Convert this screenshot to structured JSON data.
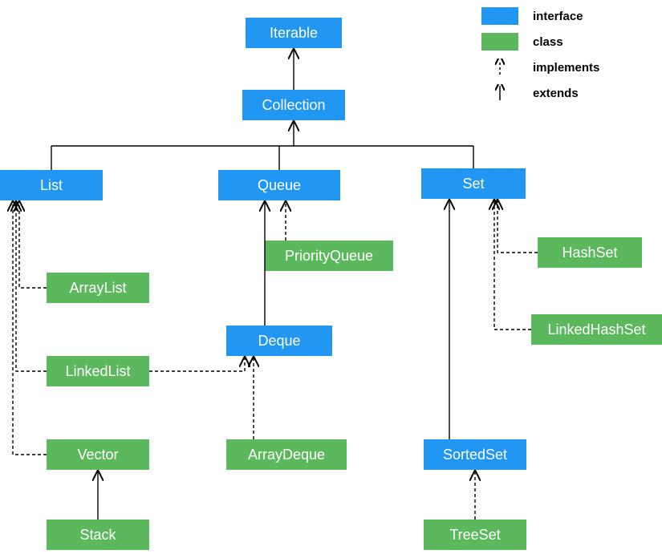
{
  "legend": {
    "interface": "interface",
    "class": "class",
    "implements": "implements",
    "extends": "extends"
  },
  "nodes": {
    "iterable": "Iterable",
    "collection": "Collection",
    "list": "List",
    "queue": "Queue",
    "set": "Set",
    "deque": "Deque",
    "sortedset": "SortedSet",
    "arraylist": "ArrayList",
    "linkedlist": "LinkedList",
    "vector": "Vector",
    "stack": "Stack",
    "priorityqueue": "PriorityQueue",
    "arraydeque": "ArrayDeque",
    "hashset": "HashSet",
    "linkedhashset": "LinkedHashSet",
    "treeset": "TreeSet"
  },
  "colors": {
    "interface": "#2196f3",
    "class": "#5cb85c"
  },
  "edges": [
    {
      "from": "collection",
      "to": "iterable",
      "kind": "extends"
    },
    {
      "from": "list",
      "to": "collection",
      "kind": "extends"
    },
    {
      "from": "queue",
      "to": "collection",
      "kind": "extends"
    },
    {
      "from": "set",
      "to": "collection",
      "kind": "extends"
    },
    {
      "from": "deque",
      "to": "queue",
      "kind": "extends"
    },
    {
      "from": "sortedset",
      "to": "set",
      "kind": "extends"
    },
    {
      "from": "stack",
      "to": "vector",
      "kind": "extends"
    },
    {
      "from": "arraylist",
      "to": "list",
      "kind": "implements"
    },
    {
      "from": "linkedlist",
      "to": "list",
      "kind": "implements"
    },
    {
      "from": "linkedlist",
      "to": "deque",
      "kind": "implements"
    },
    {
      "from": "vector",
      "to": "list",
      "kind": "implements"
    },
    {
      "from": "priorityqueue",
      "to": "queue",
      "kind": "implements"
    },
    {
      "from": "arraydeque",
      "to": "deque",
      "kind": "implements"
    },
    {
      "from": "hashset",
      "to": "set",
      "kind": "implements"
    },
    {
      "from": "linkedhashset",
      "to": "set",
      "kind": "implements"
    },
    {
      "from": "treeset",
      "to": "sortedset",
      "kind": "implements"
    }
  ]
}
